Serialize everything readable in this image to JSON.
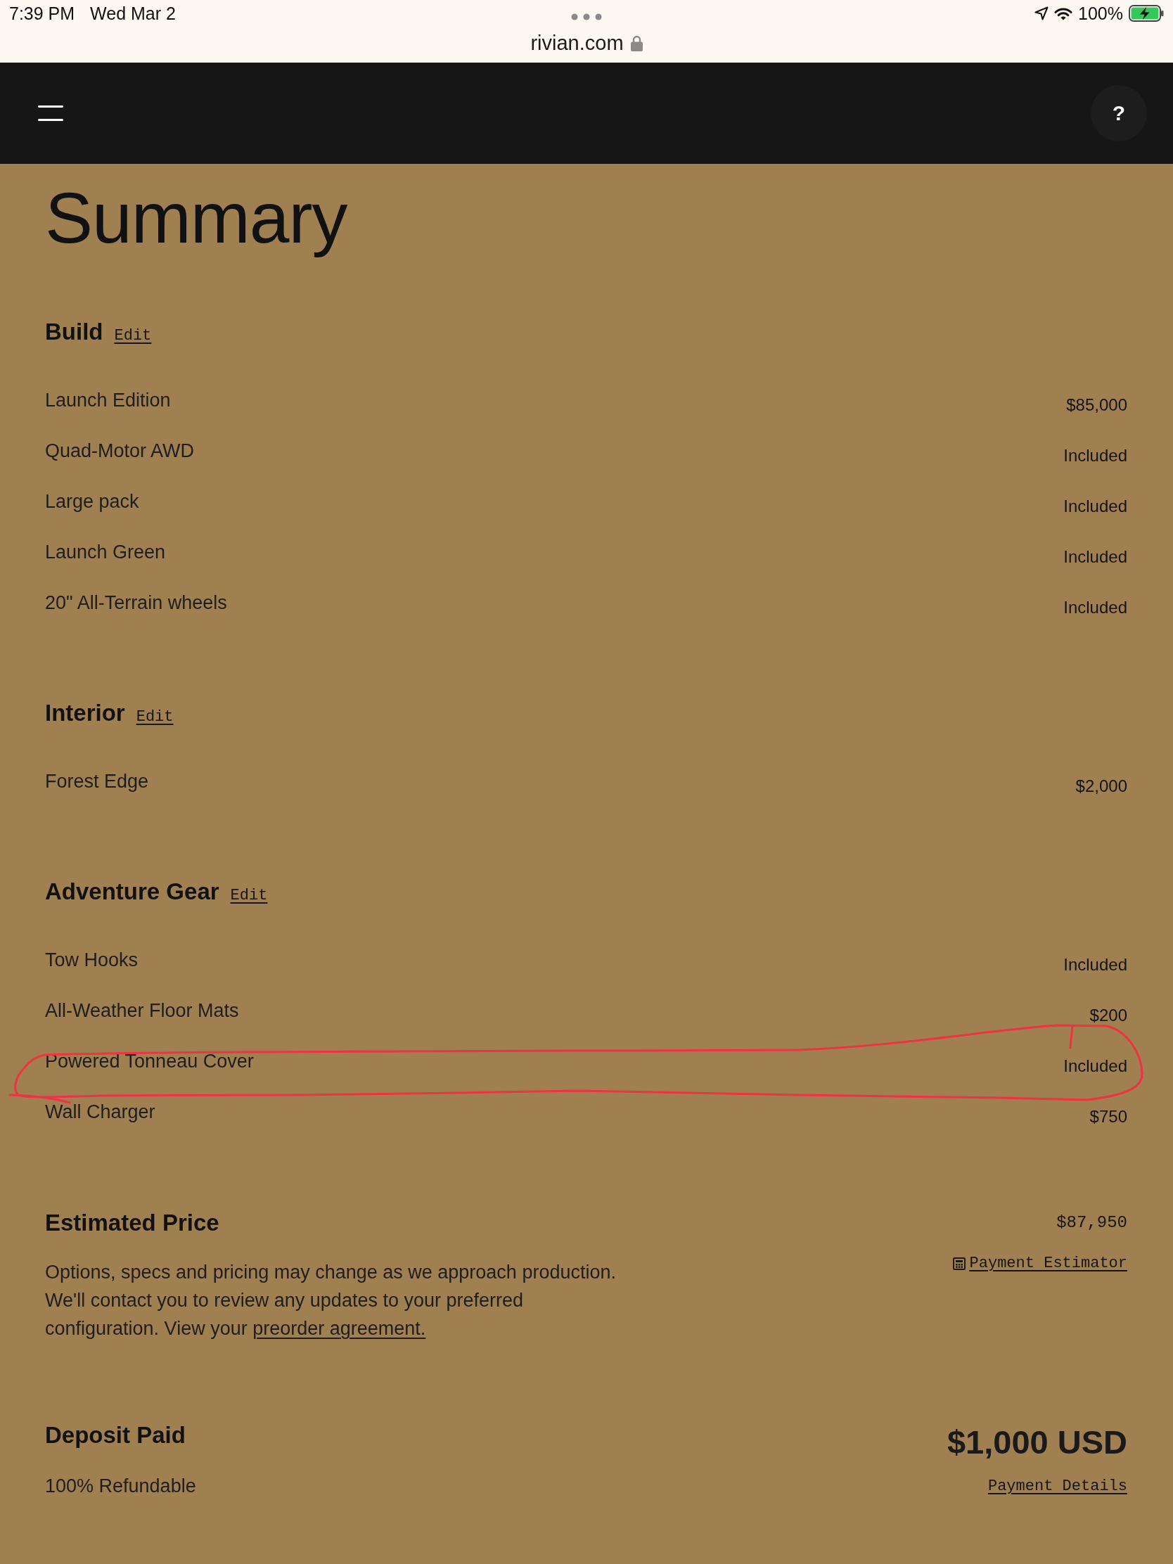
{
  "status_bar": {
    "time": "7:39 PM",
    "date": "Wed Mar 2",
    "battery_percent": "100%"
  },
  "address_bar": {
    "url": "rivian.com"
  },
  "header": {
    "help_label": "?"
  },
  "title": "Summary",
  "sections": [
    {
      "title": "Build",
      "edit_link": "Edit",
      "items": [
        {
          "name": "Launch Edition",
          "price": "$85,000",
          "circled": false
        },
        {
          "name": "Quad-Motor AWD",
          "price": "Included",
          "circled": false
        },
        {
          "name": "Large pack",
          "price": "Included",
          "circled": false
        },
        {
          "name": "Launch Green",
          "price": "Included",
          "circled": false
        },
        {
          "name": "20\" All-Terrain wheels",
          "price": "Included",
          "circled": false
        }
      ]
    },
    {
      "title": "Interior",
      "edit_link": "Edit",
      "items": [
        {
          "name": "Forest Edge",
          "price": "$2,000",
          "circled": false
        }
      ]
    },
    {
      "title": "Adventure Gear",
      "edit_link": "Edit",
      "items": [
        {
          "name": "Tow Hooks",
          "price": "Included",
          "circled": false
        },
        {
          "name": "All-Weather Floor Mats",
          "price": "$200",
          "circled": false
        },
        {
          "name": "Powered Tonneau Cover",
          "price": "Included",
          "circled": true
        },
        {
          "name": "Wall Charger",
          "price": "$750",
          "circled": false
        }
      ]
    }
  ],
  "estimated_price": {
    "title": "Estimated Price",
    "amount": "$87,950",
    "note": "Options, specs and pricing may change as we approach production. We'll contact you to review any updates to your preferred configuration. View your",
    "note_link": "preorder agreement.",
    "estimator_link": "Payment Estimator"
  },
  "deposit": {
    "title": "Deposit Paid",
    "amount": "$1,000 USD",
    "note": "100% Refundable",
    "details_link": "Payment Details"
  }
}
